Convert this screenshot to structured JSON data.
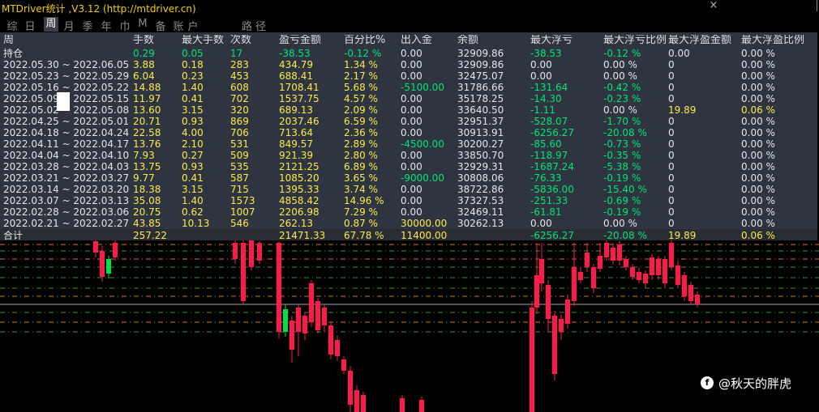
{
  "app": {
    "title": "MTDriver统计 ,V3.12 (http://mtdriver.cn)",
    "close_icon": "×"
  },
  "tabs": {
    "items": [
      "综",
      "日",
      "周",
      "月",
      "季",
      "年",
      "巾",
      "M",
      "备",
      "账",
      "户"
    ],
    "active_index": 2,
    "path_label": "路径"
  },
  "table": {
    "columns": [
      "周",
      "手数",
      "最大手数",
      "次数",
      "盈亏金额",
      "百分比%",
      "出入金",
      "余额",
      "最大浮亏",
      "最大浮亏比例",
      "最大浮盈金额",
      "最大浮盈比例"
    ],
    "rows": [
      [
        "持仓",
        "0.29",
        "0.05",
        "17",
        "-38.53",
        "-0.12 %",
        "0.00",
        "32909.86",
        "-38.53",
        "-0.12 %",
        "0.00",
        "0.00 %"
      ],
      [
        "2022.05.30 ~ 2022.06.05",
        "3.88",
        "0.18",
        "283",
        "434.79",
        "1.34 %",
        "0.00",
        "32909.86",
        "0.00",
        "0.00 %",
        "0",
        "0.00 %"
      ],
      [
        "2022.05.23 ~ 2022.05.29",
        "6.04",
        "0.23",
        "453",
        "688.41",
        "2.17 %",
        "0.00",
        "32475.07",
        "0.00",
        "0.00 %",
        "0",
        "0.00 %"
      ],
      [
        "2022.05.16 ~ 2022.05.22",
        "14.88",
        "1.40",
        "608",
        "1708.41",
        "5.68 %",
        "-5100.00",
        "31786.66",
        "-131.64",
        "-0.42 %",
        "0",
        "0.00 %"
      ],
      [
        "2022.05.09 ~ 2022.05.15",
        "11.97",
        "0.41",
        "702",
        "1537.75",
        "4.57 %",
        "0.00",
        "35178.25",
        "-14.30",
        "-0.23 %",
        "0",
        "0.00 %"
      ],
      [
        "2022.05.02 ~ 2022.05.08",
        "13.60",
        "3.15",
        "320",
        "689.13",
        "2.09 %",
        "0.00",
        "33640.50",
        "-1.11",
        "0.00 %",
        "19.89",
        "0.06 %"
      ],
      [
        "2022.04.25 ~ 2022.05.01",
        "20.71",
        "0.93",
        "869",
        "2037.46",
        "6.59 %",
        "0.00",
        "32951.37",
        "-528.07",
        "-1.70 %",
        "0",
        "0.00 %"
      ],
      [
        "2022.04.18 ~ 2022.04.24",
        "22.58",
        "4.00",
        "706",
        "713.64",
        "2.36 %",
        "0.00",
        "30913.91",
        "-6256.27",
        "-20.08 %",
        "0",
        "0.00 %"
      ],
      [
        "2022.04.11 ~ 2022.04.17",
        "13.76",
        "2.10",
        "531",
        "849.57",
        "2.89 %",
        "-4500.00",
        "30200.27",
        "-85.60",
        "-0.73 %",
        "0",
        "0.00 %"
      ],
      [
        "2022.04.04 ~ 2022.04.10",
        "7.93",
        "0.27",
        "509",
        "921.39",
        "2.80 %",
        "0.00",
        "33850.70",
        "-118.97",
        "-0.35 %",
        "0",
        "0.00 %"
      ],
      [
        "2022.03.28 ~ 2022.04.03",
        "13.75",
        "0.93",
        "535",
        "2121.25",
        "6.89 %",
        "0.00",
        "32929.31",
        "-1687.24",
        "-5.38 %",
        "0",
        "0.00 %"
      ],
      [
        "2022.03.21 ~ 2022.03.27",
        "9.77",
        "0.41",
        "587",
        "1085.20",
        "3.65 %",
        "-9000.00",
        "30808.06",
        "-76.33",
        "-0.19 %",
        "0",
        "0.00 %"
      ],
      [
        "2022.03.14 ~ 2022.03.20",
        "18.38",
        "3.15",
        "715",
        "1395.33",
        "3.74 %",
        "0.00",
        "38722.86",
        "-5836.00",
        "-15.40 %",
        "0",
        "0.00 %"
      ],
      [
        "2022.03.07 ~ 2022.03.13",
        "35.08",
        "1.40",
        "1573",
        "4858.42",
        "14.96 %",
        "0.00",
        "37327.53",
        "-251.33",
        "-0.69 %",
        "0",
        "0.00 %"
      ],
      [
        "2022.02.28 ~ 2022.03.06",
        "20.75",
        "0.62",
        "1007",
        "2206.98",
        "7.29 %",
        "0.00",
        "32469.11",
        "-61.81",
        "-0.19 %",
        "0",
        "0.00 %"
      ],
      [
        "2022.02.21 ~ 2022.02.27",
        "43.85",
        "10.13",
        "546",
        "262.13",
        "0.87 %",
        "30000.00",
        "30262.13",
        "0.00",
        "0.00 %",
        "0",
        "0.00 %"
      ]
    ],
    "totals": [
      "合计",
      "257.22",
      "",
      "",
      "21471.33",
      "67.78 %",
      "11400.00",
      "",
      "-6256.27",
      "-20.08 %",
      "19.89",
      "0.06 %"
    ]
  },
  "watermark": {
    "text": "@秋天的胖虎",
    "icon": "weibo-like-icon"
  },
  "colors": {
    "background": "#000000",
    "panel": "#2e3540",
    "bull": "#00e040",
    "bear": "#ff1a4a",
    "level_green": "#3cb043",
    "level_orange": "#ff8c1a"
  }
}
